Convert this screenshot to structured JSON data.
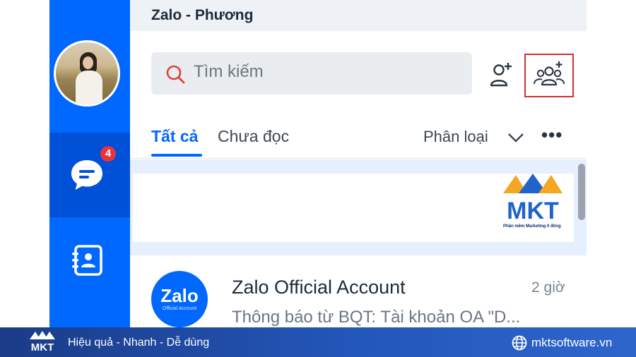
{
  "window": {
    "title": "Zalo - Phương"
  },
  "sidebar": {
    "chat_badge": "4",
    "items": [
      {
        "icon": "chat-bubble-icon",
        "active": true
      },
      {
        "icon": "contacts-icon",
        "active": false
      }
    ]
  },
  "search": {
    "placeholder": "Tìm kiếm"
  },
  "toolbar": {
    "add_friend_icon": "add-friend-icon",
    "add_group_icon": "add-group-icon"
  },
  "tabs": {
    "all_label": "Tất cả",
    "unread_label": "Chưa đọc",
    "classify_label": "Phân loại",
    "more_label": "•••"
  },
  "conversation": {
    "avatar_text": "Zalo",
    "avatar_subtext": "Official Account",
    "name": "Zalo Official Account",
    "time": "2 giờ",
    "preview": "Thông báo từ BQT: Tài khoản OA \"D..."
  },
  "watermark": {
    "brand": "MKT",
    "tagline": "Phần mềm Marketing 0 đồng"
  },
  "footer": {
    "slogan": "Hiệu quả - Nhanh - Dễ dùng",
    "website": "mktsoftware.vn"
  },
  "colors": {
    "zalo_blue": "#0068ff",
    "badge_red": "#e8343a",
    "highlight_red": "#d0312d",
    "footer_blue": "#2356b9"
  }
}
